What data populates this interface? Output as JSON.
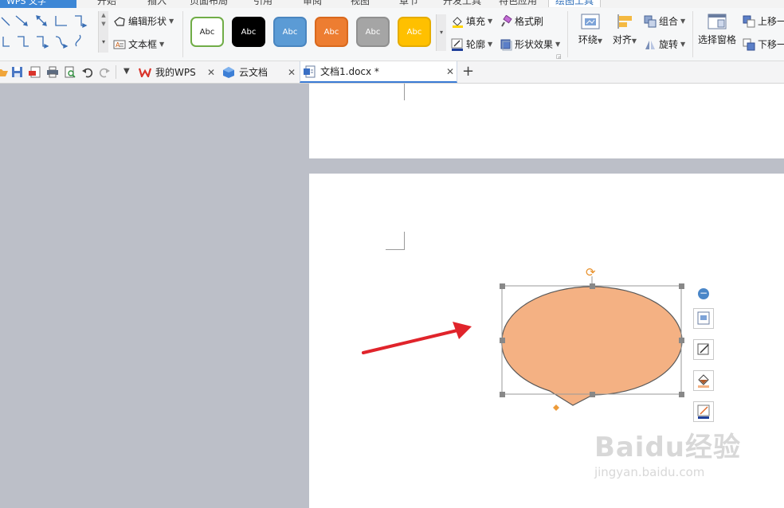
{
  "app": {
    "label": "WPS 文字"
  },
  "menu": {
    "tabs": [
      "开始",
      "插入",
      "页面布局",
      "引用",
      "审阅",
      "视图",
      "章节",
      "开发工具",
      "特色应用",
      "绘图工具"
    ],
    "active_tab": "绘图工具"
  },
  "ribbon": {
    "edit_shape": "编辑形状",
    "text_box": "文本框",
    "shape_styles": [
      {
        "label": "Abc",
        "fill": "#ffffff",
        "border": "#70ad47",
        "text": "#222222"
      },
      {
        "label": "Abc",
        "fill": "#000000",
        "border": "#000000",
        "text": "#ffffff"
      },
      {
        "label": "Abc",
        "fill": "#5b9bd5",
        "border": "#4a86c0",
        "text": "#ffffff"
      },
      {
        "label": "Abc",
        "fill": "#ed7d31",
        "border": "#d9691e",
        "text": "#ffffff"
      },
      {
        "label": "Abc",
        "fill": "#a5a5a5",
        "border": "#909090",
        "text": "#ffffff"
      },
      {
        "label": "Abc",
        "fill": "#ffc000",
        "border": "#e5ac00",
        "text": "#ffffff"
      }
    ],
    "fill": "填充",
    "format_painter": "格式刷",
    "outline": "轮廓",
    "shape_effects": "形状效果",
    "wrap": "环绕",
    "align": "对齐",
    "group": "组合",
    "rotate": "旋转",
    "selection_pane": "选择窗格",
    "bring_forward": "上移一",
    "send_backward": "下移一"
  },
  "doc_tabs": {
    "tabs": [
      {
        "label": "我的WPS",
        "icon": "wps-logo-icon"
      },
      {
        "label": "云文档",
        "icon": "cloud-doc-icon"
      },
      {
        "label": "文档1.docx *",
        "icon": "doc-file-icon",
        "active": true
      }
    ],
    "new_tab": "+"
  },
  "shape": {
    "fill": "#f4b183",
    "outline": "#595959",
    "type": "oval-callout"
  },
  "colors": {
    "accent": "#2b6cb8",
    "arrow": "#e0242b",
    "canvas": "#bcbfc8"
  },
  "watermark": {
    "brand": "Baidu经验",
    "url": "jingyan.baidu.com"
  }
}
